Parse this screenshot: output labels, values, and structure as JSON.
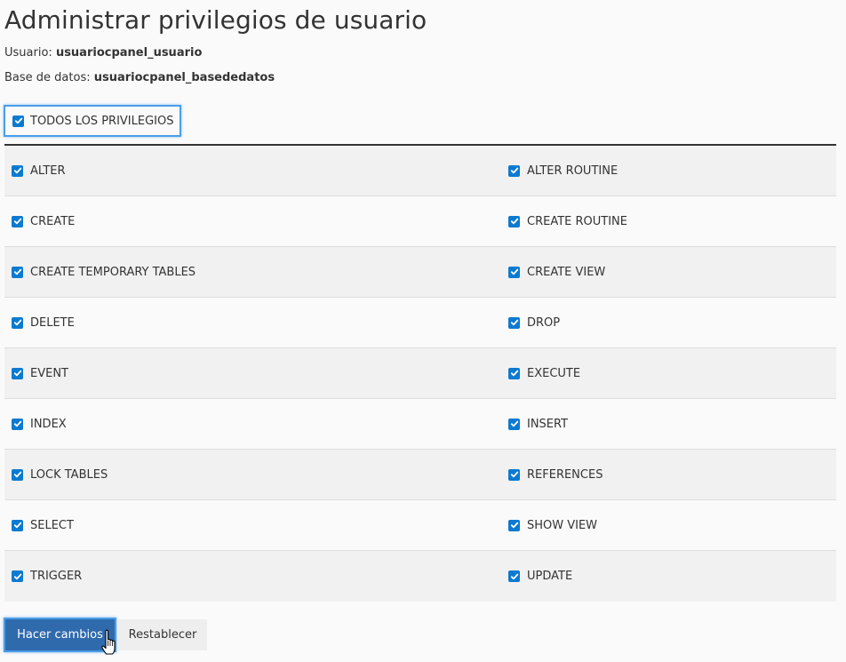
{
  "page": {
    "title": "Administrar privilegios de usuario",
    "user_label": "Usuario:",
    "user_value": "usuariocpanel_usuario",
    "db_label": "Base de datos:",
    "db_value": "usuariocpanel_basededatos"
  },
  "all_privileges": {
    "label": "TODOS LOS PRIVILEGIOS",
    "checked": true
  },
  "privileges": {
    "rows": [
      {
        "left": "ALTER",
        "right": "ALTER ROUTINE"
      },
      {
        "left": "CREATE",
        "right": "CREATE ROUTINE"
      },
      {
        "left": "CREATE TEMPORARY TABLES",
        "right": "CREATE VIEW"
      },
      {
        "left": "DELETE",
        "right": "DROP"
      },
      {
        "left": "EVENT",
        "right": "EXECUTE"
      },
      {
        "left": "INDEX",
        "right": "INSERT"
      },
      {
        "left": "LOCK TABLES",
        "right": "REFERENCES"
      },
      {
        "left": "SELECT",
        "right": "SHOW VIEW"
      },
      {
        "left": "TRIGGER",
        "right": "UPDATE"
      }
    ]
  },
  "actions": {
    "submit_label": "Hacer cambios",
    "reset_label": "Restablecer"
  },
  "colors": {
    "checkbox": "#0b7ad1",
    "primary_button": "#2f6aad",
    "focus_ring": "#4a9ee8"
  },
  "icons": {
    "checkbox": "checkmark-icon",
    "cursor": "hand-pointer-icon"
  }
}
